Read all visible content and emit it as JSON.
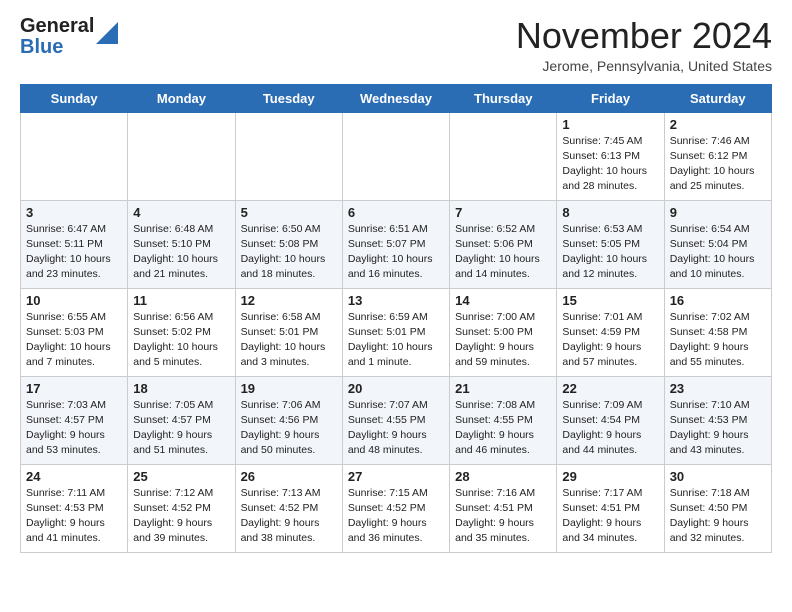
{
  "header": {
    "logo_general": "General",
    "logo_blue": "Blue",
    "month_title": "November 2024",
    "location": "Jerome, Pennsylvania, United States"
  },
  "weekdays": [
    "Sunday",
    "Monday",
    "Tuesday",
    "Wednesday",
    "Thursday",
    "Friday",
    "Saturday"
  ],
  "weeks": [
    [
      {
        "day": "",
        "info": ""
      },
      {
        "day": "",
        "info": ""
      },
      {
        "day": "",
        "info": ""
      },
      {
        "day": "",
        "info": ""
      },
      {
        "day": "",
        "info": ""
      },
      {
        "day": "1",
        "info": "Sunrise: 7:45 AM\nSunset: 6:13 PM\nDaylight: 10 hours\nand 28 minutes."
      },
      {
        "day": "2",
        "info": "Sunrise: 7:46 AM\nSunset: 6:12 PM\nDaylight: 10 hours\nand 25 minutes."
      }
    ],
    [
      {
        "day": "3",
        "info": "Sunrise: 6:47 AM\nSunset: 5:11 PM\nDaylight: 10 hours\nand 23 minutes."
      },
      {
        "day": "4",
        "info": "Sunrise: 6:48 AM\nSunset: 5:10 PM\nDaylight: 10 hours\nand 21 minutes."
      },
      {
        "day": "5",
        "info": "Sunrise: 6:50 AM\nSunset: 5:08 PM\nDaylight: 10 hours\nand 18 minutes."
      },
      {
        "day": "6",
        "info": "Sunrise: 6:51 AM\nSunset: 5:07 PM\nDaylight: 10 hours\nand 16 minutes."
      },
      {
        "day": "7",
        "info": "Sunrise: 6:52 AM\nSunset: 5:06 PM\nDaylight: 10 hours\nand 14 minutes."
      },
      {
        "day": "8",
        "info": "Sunrise: 6:53 AM\nSunset: 5:05 PM\nDaylight: 10 hours\nand 12 minutes."
      },
      {
        "day": "9",
        "info": "Sunrise: 6:54 AM\nSunset: 5:04 PM\nDaylight: 10 hours\nand 10 minutes."
      }
    ],
    [
      {
        "day": "10",
        "info": "Sunrise: 6:55 AM\nSunset: 5:03 PM\nDaylight: 10 hours\nand 7 minutes."
      },
      {
        "day": "11",
        "info": "Sunrise: 6:56 AM\nSunset: 5:02 PM\nDaylight: 10 hours\nand 5 minutes."
      },
      {
        "day": "12",
        "info": "Sunrise: 6:58 AM\nSunset: 5:01 PM\nDaylight: 10 hours\nand 3 minutes."
      },
      {
        "day": "13",
        "info": "Sunrise: 6:59 AM\nSunset: 5:01 PM\nDaylight: 10 hours\nand 1 minute."
      },
      {
        "day": "14",
        "info": "Sunrise: 7:00 AM\nSunset: 5:00 PM\nDaylight: 9 hours\nand 59 minutes."
      },
      {
        "day": "15",
        "info": "Sunrise: 7:01 AM\nSunset: 4:59 PM\nDaylight: 9 hours\nand 57 minutes."
      },
      {
        "day": "16",
        "info": "Sunrise: 7:02 AM\nSunset: 4:58 PM\nDaylight: 9 hours\nand 55 minutes."
      }
    ],
    [
      {
        "day": "17",
        "info": "Sunrise: 7:03 AM\nSunset: 4:57 PM\nDaylight: 9 hours\nand 53 minutes."
      },
      {
        "day": "18",
        "info": "Sunrise: 7:05 AM\nSunset: 4:57 PM\nDaylight: 9 hours\nand 51 minutes."
      },
      {
        "day": "19",
        "info": "Sunrise: 7:06 AM\nSunset: 4:56 PM\nDaylight: 9 hours\nand 50 minutes."
      },
      {
        "day": "20",
        "info": "Sunrise: 7:07 AM\nSunset: 4:55 PM\nDaylight: 9 hours\nand 48 minutes."
      },
      {
        "day": "21",
        "info": "Sunrise: 7:08 AM\nSunset: 4:55 PM\nDaylight: 9 hours\nand 46 minutes."
      },
      {
        "day": "22",
        "info": "Sunrise: 7:09 AM\nSunset: 4:54 PM\nDaylight: 9 hours\nand 44 minutes."
      },
      {
        "day": "23",
        "info": "Sunrise: 7:10 AM\nSunset: 4:53 PM\nDaylight: 9 hours\nand 43 minutes."
      }
    ],
    [
      {
        "day": "24",
        "info": "Sunrise: 7:11 AM\nSunset: 4:53 PM\nDaylight: 9 hours\nand 41 minutes."
      },
      {
        "day": "25",
        "info": "Sunrise: 7:12 AM\nSunset: 4:52 PM\nDaylight: 9 hours\nand 39 minutes."
      },
      {
        "day": "26",
        "info": "Sunrise: 7:13 AM\nSunset: 4:52 PM\nDaylight: 9 hours\nand 38 minutes."
      },
      {
        "day": "27",
        "info": "Sunrise: 7:15 AM\nSunset: 4:52 PM\nDaylight: 9 hours\nand 36 minutes."
      },
      {
        "day": "28",
        "info": "Sunrise: 7:16 AM\nSunset: 4:51 PM\nDaylight: 9 hours\nand 35 minutes."
      },
      {
        "day": "29",
        "info": "Sunrise: 7:17 AM\nSunset: 4:51 PM\nDaylight: 9 hours\nand 34 minutes."
      },
      {
        "day": "30",
        "info": "Sunrise: 7:18 AM\nSunset: 4:50 PM\nDaylight: 9 hours\nand 32 minutes."
      }
    ]
  ]
}
